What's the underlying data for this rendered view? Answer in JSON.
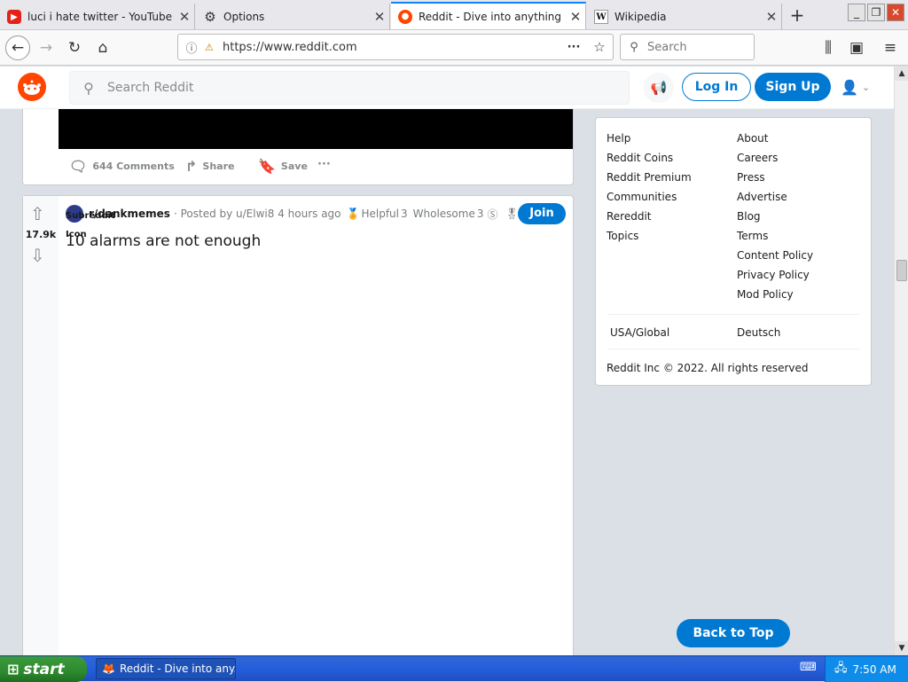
{
  "browser": {
    "tabs": [
      {
        "title": "luci i hate twitter - YouTube",
        "favicon": "youtube-icon"
      },
      {
        "title": "Options",
        "favicon": "gear-icon"
      },
      {
        "title": "Reddit - Dive into anything",
        "favicon": "reddit-icon",
        "active": true
      },
      {
        "title": "Wikipedia",
        "favicon": "wikipedia-icon"
      }
    ],
    "url": "https://www.reddit.com",
    "search_placeholder": "Search"
  },
  "reddit_header": {
    "search_placeholder": "Search Reddit",
    "login_label": "Log In",
    "signup_label": "Sign Up"
  },
  "post1": {
    "comments_label": "644 Comments",
    "share_label": "Share",
    "save_label": "Save",
    "more_label": "···"
  },
  "post2": {
    "vote_count": "17.9k",
    "subreddit_icon_alt": "Subreddit Icon",
    "subreddit": "r/dankmemes",
    "posted_by": "· Posted by u/Elwi8 4 hours ago",
    "awards": [
      {
        "label": "Helpful",
        "count": "3"
      },
      {
        "label": "Wholesome",
        "count": "3"
      }
    ],
    "join_label": "Join",
    "title": "10 alarms are not enough"
  },
  "sidebar": {
    "left_links": [
      "Help",
      "Reddit Coins",
      "Reddit Premium",
      "Communities",
      "Rereddit",
      "Topics"
    ],
    "right_links": [
      "About",
      "Careers",
      "Press",
      "Advertise",
      "Blog",
      "Terms",
      "Content Policy",
      "Privacy Policy",
      "Mod Policy"
    ],
    "language_left": "USA/Global",
    "language_right": "Deutsch",
    "copyright": "Reddit Inc © 2022. All rights reserved"
  },
  "back_to_top_label": "Back to Top",
  "taskbar": {
    "start_label": "start",
    "task_item": "Reddit - Dive into any...",
    "clock": "7:50 AM"
  },
  "colors": {
    "reddit_blue": "#0079d3",
    "reddit_orange": "#ff4500",
    "xp_taskbar": "#245edc",
    "xp_start_green": "#2e8a2e"
  }
}
